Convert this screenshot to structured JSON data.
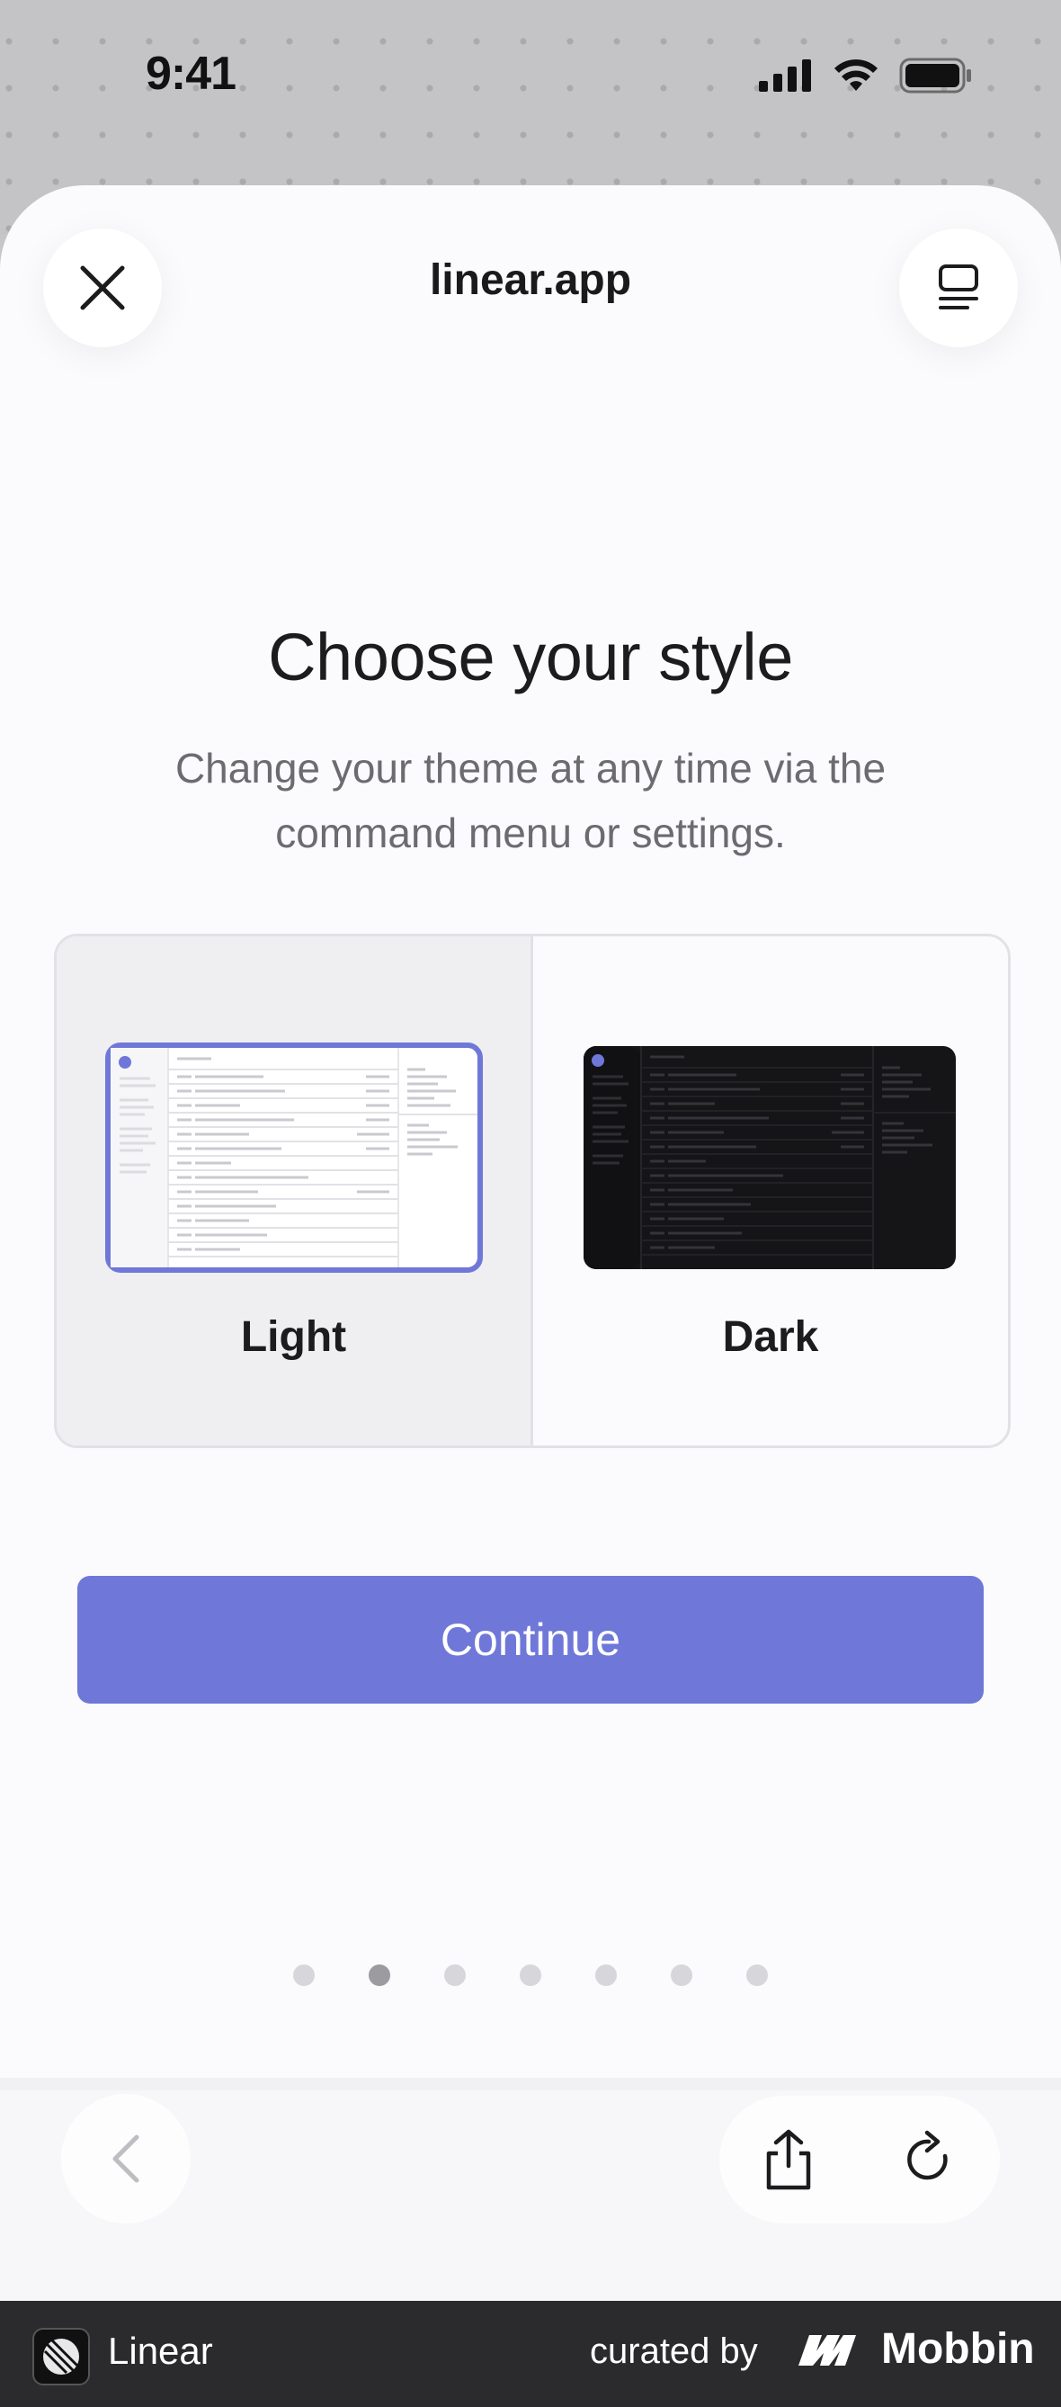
{
  "status_bar": {
    "time": "9:41"
  },
  "browser": {
    "url": "linear.app",
    "close_icon": "close-icon",
    "tabs_icon": "tabs-icon"
  },
  "onboarding": {
    "title": "Choose your style",
    "subtitle": "Change your theme at any time via the command menu or settings.",
    "themes": [
      {
        "label": "Light",
        "selected": true
      },
      {
        "label": "Dark",
        "selected": false
      }
    ],
    "continue_label": "Continue",
    "pagination": {
      "total": 7,
      "current": 2
    }
  },
  "footer": {
    "app_name": "Linear",
    "curated_by": "curated by",
    "brand": "Mobbin"
  },
  "colors": {
    "accent": "#6f78d8",
    "selected_bg": "#efeef0",
    "footer_bg": "#2b2b2d"
  }
}
